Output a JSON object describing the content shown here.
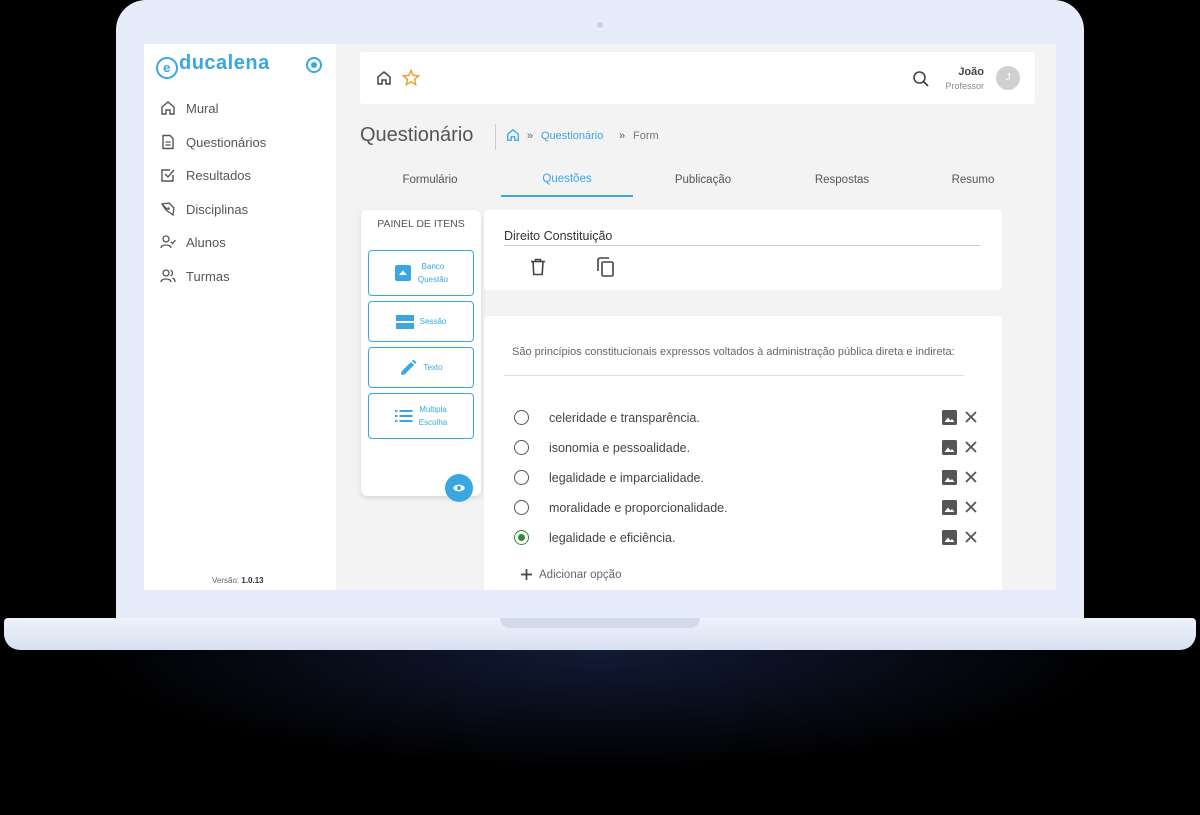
{
  "app": {
    "logo_text": "ducalena",
    "logo_letter": "e",
    "version_label": "Versão:",
    "version_value": "1.0.13"
  },
  "sidebar": {
    "items": [
      {
        "label": "Mural",
        "icon": "home-icon"
      },
      {
        "label": "Questionários",
        "icon": "document-icon"
      },
      {
        "label": "Resultados",
        "icon": "checkbox-icon"
      },
      {
        "label": "Disciplinas",
        "icon": "pen-icon"
      },
      {
        "label": "Alunos",
        "icon": "user-check-icon"
      },
      {
        "label": "Turmas",
        "icon": "users-icon"
      }
    ]
  },
  "header": {
    "user_name": "João",
    "user_role": "Professor",
    "avatar_initial": "J"
  },
  "page": {
    "title": "Questionário",
    "breadcrumb": {
      "sep": "»",
      "link": "Questionário",
      "current": "Form"
    }
  },
  "tabs": [
    "Formulário",
    "Questões",
    "Publicação",
    "Respostas",
    "Resumo"
  ],
  "active_tab": "Questões",
  "panel": {
    "title": "PAINEL DE ITENS",
    "buttons": [
      {
        "line1": "Banco",
        "line2": "Questão"
      },
      {
        "line1": "Sessão",
        "line2": ""
      },
      {
        "line1": "Texto",
        "line2": ""
      },
      {
        "line1": "Multipla",
        "line2": "Escolha"
      }
    ]
  },
  "question": {
    "section_title": "Direito Constituição",
    "text": "São princípios constitucionais expressos voltados à administração pública direta e indireta:",
    "options": [
      {
        "label": "celeridade e transparência.",
        "selected": false
      },
      {
        "label": "isonomia e pessoalidade.",
        "selected": false
      },
      {
        "label": "legalidade e imparcialidade.",
        "selected": false
      },
      {
        "label": "moralidade e proporcionalidade.",
        "selected": false
      },
      {
        "label": "legalidade e eficiência.",
        "selected": true
      }
    ],
    "add_option_label": "Adicionar opção"
  },
  "colors": {
    "accent": "#3aa7e0",
    "selected": "#2e8b2e",
    "star": "#f0a030"
  }
}
